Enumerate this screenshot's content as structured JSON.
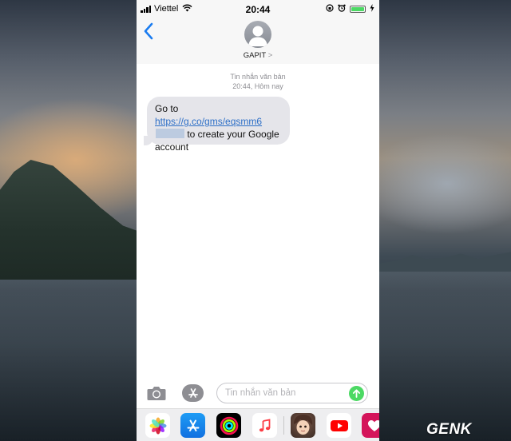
{
  "status_bar": {
    "carrier": "Viettel",
    "time": "20:44"
  },
  "header": {
    "contact_name": "GAPIT",
    "contact_chevron": ">"
  },
  "thread": {
    "message_type": "Tin nhắn văn bản",
    "timestamp": "20:44, Hôm nay",
    "message": {
      "prefix": "Go to ",
      "link_line1": "https://g.co/gms/",
      "link_line2": "eqsmm6",
      "suffix": " to create your Google account"
    }
  },
  "composer": {
    "placeholder": "Tin nhắn văn bản"
  },
  "app_strip": {
    "apps": [
      "photos-icon",
      "app-store-icon",
      "activity-icon",
      "music-icon",
      "memoji-sticker-icon",
      "youtube-icon",
      "heart-app-icon"
    ]
  },
  "watermark": {
    "logo": "GENK"
  },
  "colors": {
    "link": "#2d6fc7",
    "bubble": "#e5e5ea",
    "send": "#4cd964",
    "ios_blue": "#1a7cf0"
  }
}
